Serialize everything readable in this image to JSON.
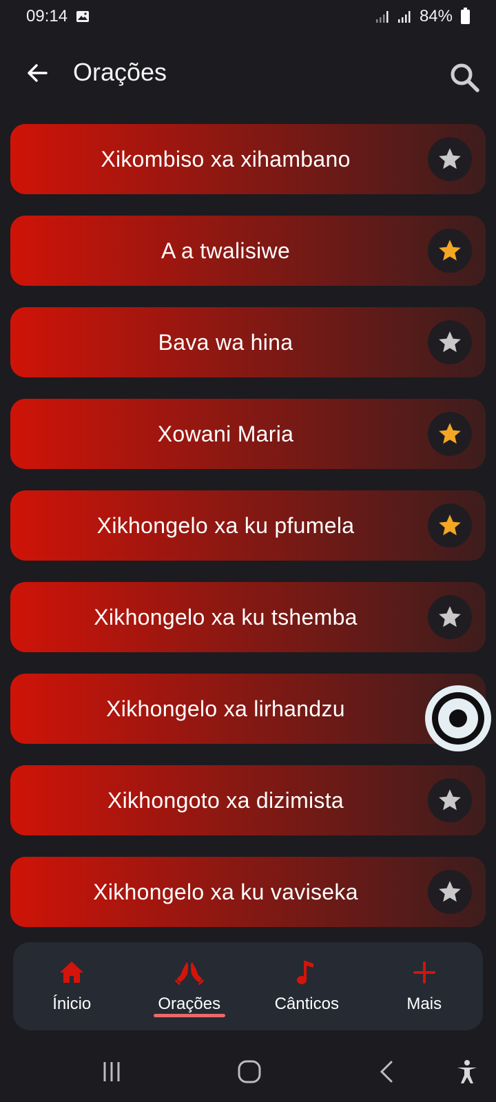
{
  "status_bar": {
    "time": "09:14",
    "battery": "84%"
  },
  "app_bar": {
    "title": "Orações"
  },
  "prayers": [
    {
      "label": "Xikombiso xa xihambano",
      "favorite": false
    },
    {
      "label": "A a twalisiwe",
      "favorite": true
    },
    {
      "label": "Bava wa hina",
      "favorite": false
    },
    {
      "label": "Xowani Maria",
      "favorite": true
    },
    {
      "label": "Xikhongelo xa ku pfumela",
      "favorite": true
    },
    {
      "label": "Xikhongelo xa ku tshemba",
      "favorite": false
    },
    {
      "label": "Xikhongelo xa lirhandzu",
      "favorite": false
    },
    {
      "label": "Xikhongoto xa dizimista",
      "favorite": false
    },
    {
      "label": "Xikhongelo xa ku vaviseka",
      "favorite": false
    }
  ],
  "colors": {
    "accent": "#d4140a",
    "star_on": "#f5a623",
    "star_off": "#c9c9c9",
    "nav_bg": "#252a33",
    "underline": "#e86a6a"
  },
  "bottom_nav": {
    "items": [
      {
        "label": "Ínicio",
        "icon": "home-icon",
        "active": false
      },
      {
        "label": "Orações",
        "icon": "praying-hands-icon",
        "active": true
      },
      {
        "label": "Cânticos",
        "icon": "music-note-icon",
        "active": false
      },
      {
        "label": "Mais",
        "icon": "plus-icon",
        "active": false
      }
    ]
  }
}
